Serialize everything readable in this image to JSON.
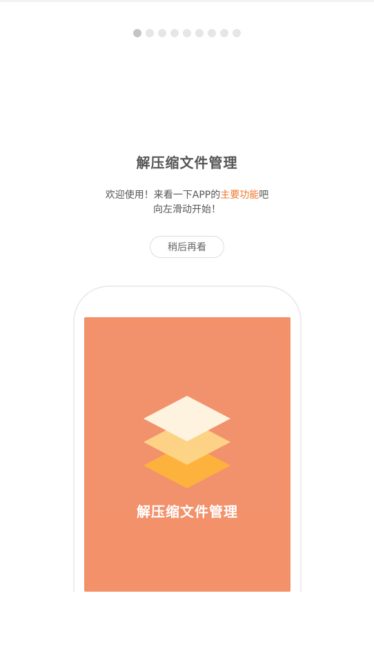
{
  "pager": {
    "total": 9,
    "active_index": 0
  },
  "intro": {
    "title": "解压缩文件管理",
    "line1_prefix": "欢迎使用！来看一下APP的",
    "line1_highlight": "主要功能",
    "line1_suffix": "吧",
    "line2": "向左滑动开始！"
  },
  "later_button": {
    "label": "稍后再看"
  },
  "splash": {
    "title": "解压缩文件管理"
  },
  "colors": {
    "highlight": "#f0772a",
    "splash_bg": "#f2916a",
    "layer_top": "#fdf3df",
    "layer_mid": "#fdd488",
    "layer_bottom": "#fdb23d"
  }
}
